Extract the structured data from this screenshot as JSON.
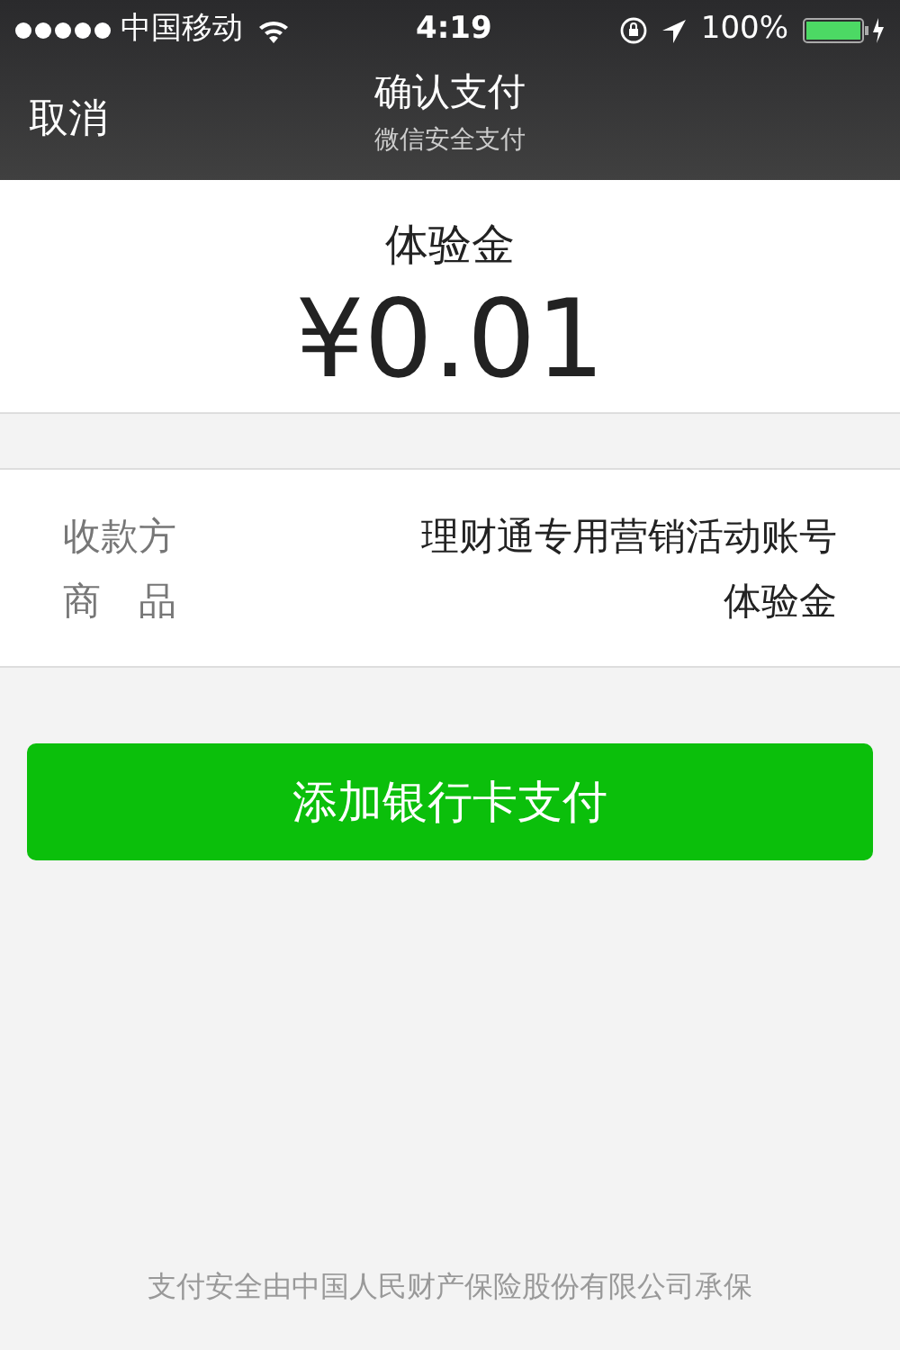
{
  "status_bar": {
    "carrier": "中国移动",
    "time": "4:19",
    "battery": "100%"
  },
  "nav": {
    "cancel": "取消",
    "title": "确认支付",
    "subtitle": "微信安全支付"
  },
  "order": {
    "product": "体验金",
    "amount": "¥0.01"
  },
  "details": [
    {
      "label": "收款方",
      "value": "理财通专用营销活动账号"
    },
    {
      "label": "商　品",
      "value": "体验金"
    }
  ],
  "pay_button": "添加银行卡支付",
  "footer": "支付安全由中国人民财产保险股份有限公司承保"
}
